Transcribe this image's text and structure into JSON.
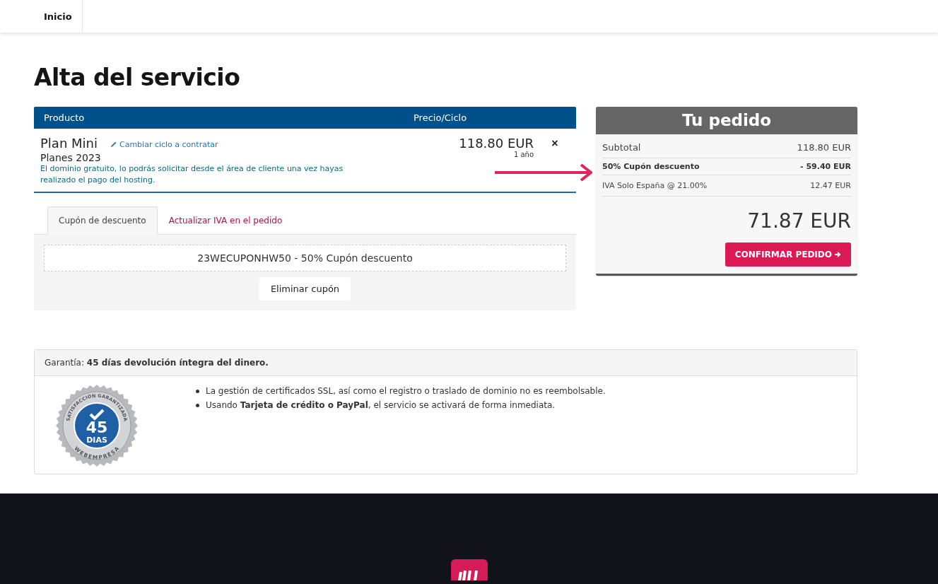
{
  "nav": {
    "items": [
      {
        "label": "Inicio"
      }
    ]
  },
  "title": "Alta del servicio",
  "cart": {
    "columns": [
      "Producto",
      "Precio/Ciclo"
    ],
    "item": {
      "name": "Plan Mini",
      "edit_link": "Cambiar ciclo a contratar",
      "group": "Planes 2023",
      "note": "El dominio gratuito, lo podrás solicitar desde el área de cliente una vez hayas realizado el pago del hosting.",
      "price": "118.80 EUR",
      "cycle": "1 año",
      "remove": "×"
    }
  },
  "tabs": [
    {
      "label": "Cupón de descuento",
      "selected": true
    },
    {
      "label": "Actualizar IVA en el pedido",
      "selected": false
    }
  ],
  "coupon": {
    "value": "23WECUPONHW50 - 50% Cupón descuento",
    "button": "Eliminar cupón"
  },
  "order": {
    "title": "Tu pedido",
    "lines": [
      {
        "label": "Subtotal",
        "amount": "118.80 EUR",
        "kind": "normal"
      },
      {
        "label": "50% Cupón descuento",
        "amount": "- 59.40 EUR",
        "kind": "bold"
      },
      {
        "label": "IVA Solo España @ 21.00%",
        "amount": "12.47 EUR",
        "kind": "small"
      }
    ],
    "total": "71.87 EUR",
    "button": "CONFIRMAR PEDIDO"
  },
  "guarantee": {
    "header": "Garantía: **45 días devolución íntegra del dinero.**",
    "seal": {
      "top": "SATISFACCIÓN GARANTIZADA",
      "number": "45",
      "unit": "DIAS",
      "bottom": "WEBEMPRESA"
    },
    "points": [
      "La gestión de certificados SSL, así como el registro o traslado de dominio no es reembolsable.",
      "Usando **Tarjeta de crédito o PayPal**, el servicio se activará de forma inmediata."
    ]
  }
}
